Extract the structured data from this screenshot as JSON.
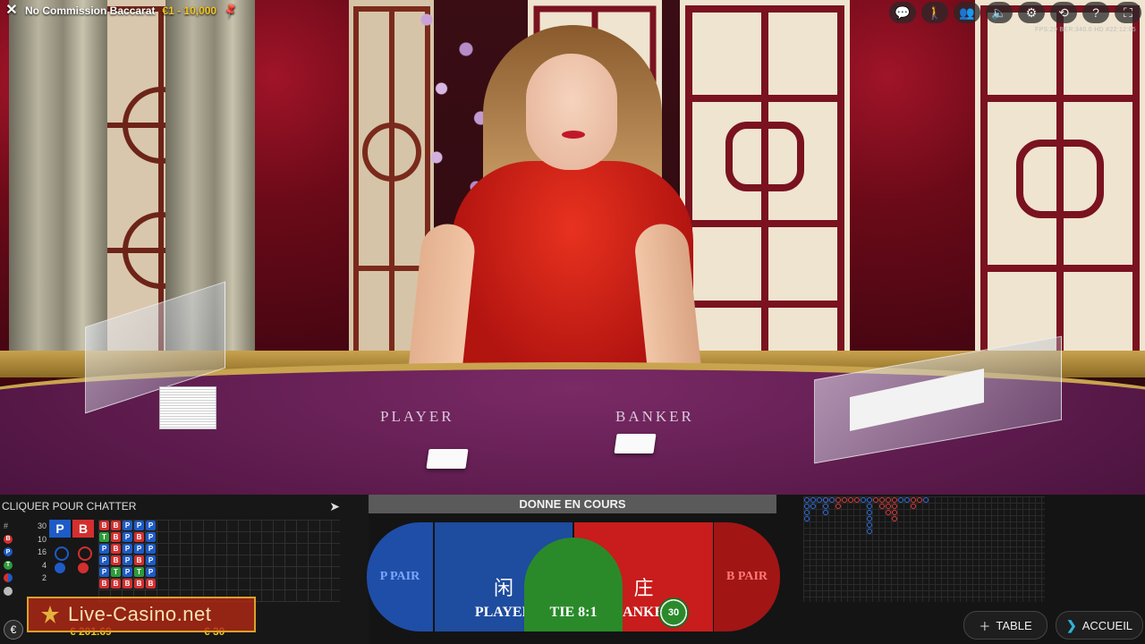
{
  "header": {
    "title": "No Commission Baccarat",
    "limits": "€1 - 10,000",
    "stats": "FPS:29 BER:340.0 HD #22:12:05"
  },
  "toolbar_icons": [
    "chat-icon",
    "accessibility-icon",
    "players-icon",
    "volume-icon",
    "settings-icon",
    "history-icon",
    "help-icon",
    "fullscreen-icon"
  ],
  "table_felt": {
    "player_label": "PLAYER",
    "banker_label": "BANKER"
  },
  "chat": {
    "placeholder": "CLIQUER POUR CHATTER"
  },
  "stats": {
    "rows": [
      {
        "key": "#",
        "value": "30"
      },
      {
        "key": "B",
        "value": "10",
        "color": "#d32f2f"
      },
      {
        "key": "P",
        "value": "16",
        "color": "#1e5bc6"
      },
      {
        "key": "T",
        "value": "4",
        "color": "#2e9b3a"
      },
      {
        "key": "",
        "value": "2"
      },
      {
        "key": "",
        "value": ""
      }
    ],
    "player_box": "P",
    "banker_box": "B"
  },
  "bead_road": [
    [
      "B",
      "T",
      "P",
      "P",
      "P",
      "B"
    ],
    [
      "B",
      "B",
      "B",
      "B",
      "T",
      "B"
    ],
    [
      "P",
      "P",
      "P",
      "P",
      "P",
      "B"
    ],
    [
      "P",
      "B",
      "P",
      "B",
      "T",
      "B"
    ],
    [
      "P",
      "P",
      "P",
      "P",
      "P",
      "B"
    ]
  ],
  "balance": {
    "amount": "€ 201.69",
    "bet_total": "€ 30"
  },
  "watermark": "Live-Casino.net",
  "status": "DONNE EN COURS",
  "bets": {
    "p_pair": "P PAIR",
    "player_cn": "闲",
    "player": "PLAYER",
    "tie": "TIE 8:1",
    "banker_cn": "庄",
    "banker": "BANKER",
    "b_pair": "B PAIR"
  },
  "chip_value": "30",
  "buttons": {
    "table": "TABLE",
    "home": "ACCUEIL"
  },
  "colors": {
    "accent": "#f3c61f",
    "player": "#1e4c9e",
    "banker": "#c91c1c",
    "tie": "#2a8a2a"
  }
}
